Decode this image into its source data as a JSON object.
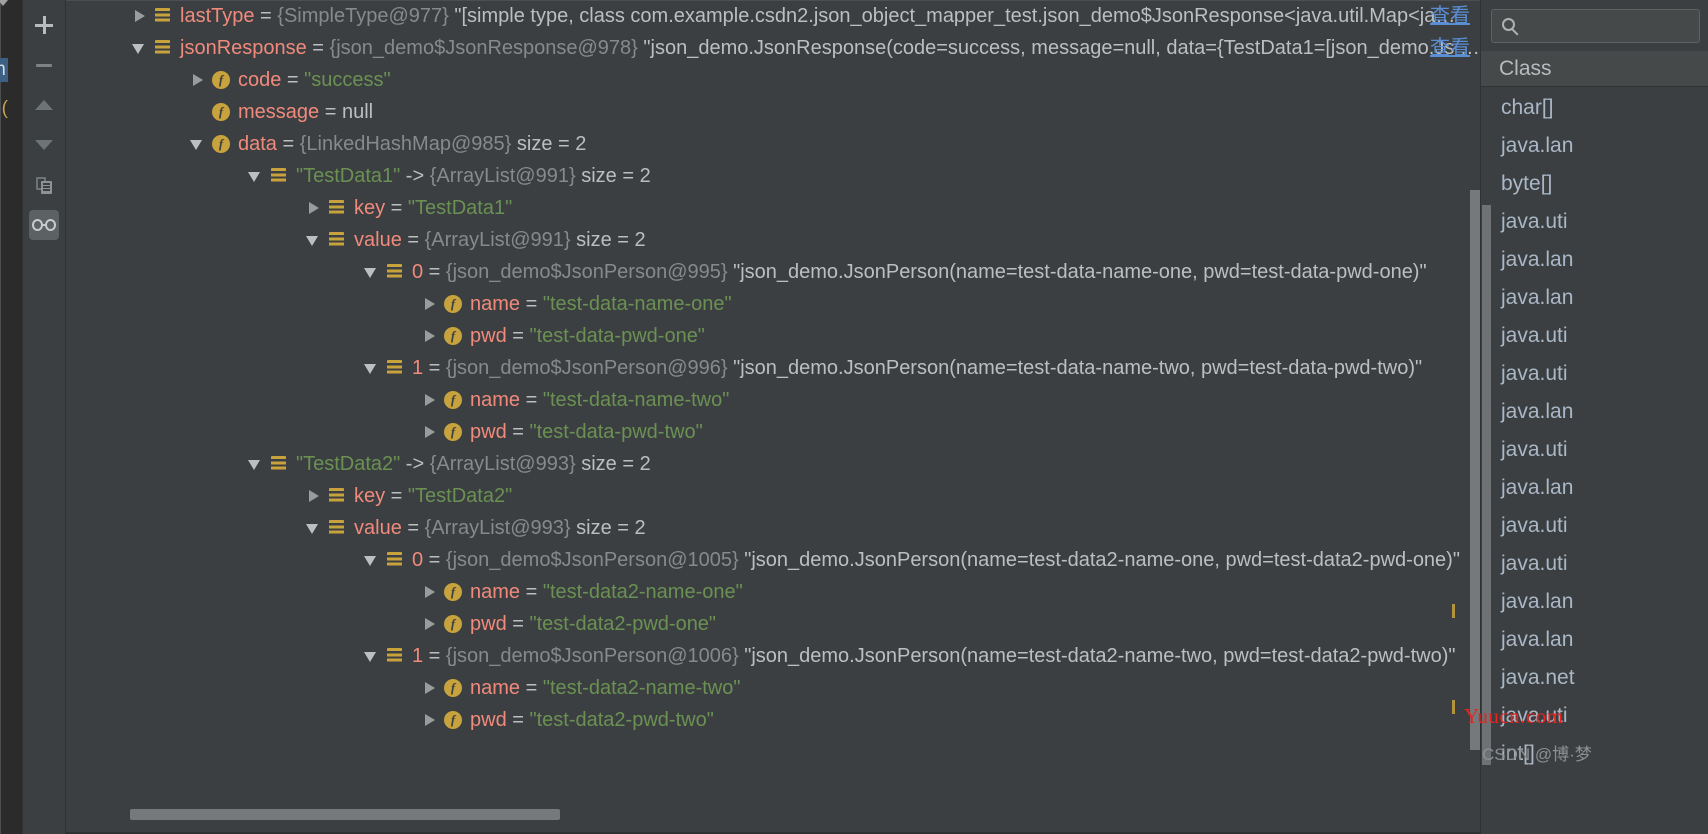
{
  "window": {
    "theme": "darcula",
    "colors": {
      "background": "#3c3f41",
      "editor_background": "#2b2b2b",
      "name": "#f08a7c",
      "type": "#868a8c",
      "string": "#6a9153",
      "plain": "#bcbfc1",
      "link": "#5a8fd6",
      "icon_gold": "#c8a23c",
      "selection": "#3d6185"
    }
  },
  "editor_sliver": {
    "selected_fragment": "m",
    "paren_fragment": ") ("
  },
  "toolbar": {
    "items": [
      {
        "name": "add-to-watches-button",
        "icon": "plus-icon",
        "label": "+",
        "active": false
      },
      {
        "name": "remove-watch-button",
        "icon": "minus-icon",
        "label": "−",
        "active": false
      },
      {
        "name": "move-watch-up-button",
        "icon": "arrow-up-icon",
        "label": "▲",
        "active": false
      },
      {
        "name": "move-watch-down-button",
        "icon": "arrow-down-icon",
        "label": "▼",
        "active": false
      },
      {
        "name": "copy-value-button",
        "icon": "copy-icon",
        "label": "⧉",
        "active": false
      },
      {
        "name": "inspect-toggle-button",
        "icon": "glasses-icon",
        "label": "∞",
        "active": true
      }
    ]
  },
  "variables_tree": {
    "rows": [
      {
        "indent": 0,
        "arrow": "collapsed",
        "icon": "node",
        "name": "lastType",
        "eq": "=",
        "type": "{SimpleType@977}",
        "tail": "\"[simple type, class com.example.csdn2.json_object_mapper_test.json_demo$JsonResponse<java.util.Map<ja…",
        "view_link": "查看"
      },
      {
        "indent": 0,
        "arrow": "expanded",
        "icon": "node",
        "name": "jsonResponse",
        "eq": "=",
        "type": "{json_demo$JsonResponse@978}",
        "tail": "\"json_demo.JsonResponse(code=success, message=null, data={TestData1=[json_demo.Js …",
        "view_link": "查看"
      },
      {
        "indent": 1,
        "arrow": "collapsed",
        "icon": "field",
        "name": "code",
        "eq": "=",
        "string": "\"success\""
      },
      {
        "indent": 1,
        "arrow": "none",
        "icon": "field",
        "name": "message",
        "eq": "=",
        "plain": "null"
      },
      {
        "indent": 1,
        "arrow": "expanded",
        "icon": "field",
        "name": "data",
        "eq": "=",
        "type": "{LinkedHashMap@985}",
        "size": "size = 2"
      },
      {
        "indent": 2,
        "arrow": "expanded",
        "icon": "node",
        "string": "\"TestData1\"",
        "arrowop": "->",
        "type": "{ArrayList@991}",
        "size": "size = 2"
      },
      {
        "indent": 3,
        "arrow": "collapsed",
        "icon": "node",
        "name": "key",
        "eq": "=",
        "string": "\"TestData1\""
      },
      {
        "indent": 3,
        "arrow": "expanded",
        "icon": "node",
        "name": "value",
        "eq": "=",
        "type": "{ArrayList@991}",
        "size": "size = 2"
      },
      {
        "indent": 4,
        "arrow": "expanded",
        "icon": "node",
        "name": "0",
        "eq": "=",
        "type": "{json_demo$JsonPerson@995}",
        "tail": "\"json_demo.JsonPerson(name=test-data-name-one, pwd=test-data-pwd-one)\""
      },
      {
        "indent": 5,
        "arrow": "collapsed",
        "icon": "field",
        "name": "name",
        "eq": "=",
        "string": "\"test-data-name-one\""
      },
      {
        "indent": 5,
        "arrow": "collapsed",
        "icon": "field",
        "name": "pwd",
        "eq": "=",
        "string": "\"test-data-pwd-one\""
      },
      {
        "indent": 4,
        "arrow": "expanded",
        "icon": "node",
        "name": "1",
        "eq": "=",
        "type": "{json_demo$JsonPerson@996}",
        "tail": "\"json_demo.JsonPerson(name=test-data-name-two, pwd=test-data-pwd-two)\""
      },
      {
        "indent": 5,
        "arrow": "collapsed",
        "icon": "field",
        "name": "name",
        "eq": "=",
        "string": "\"test-data-name-two\""
      },
      {
        "indent": 5,
        "arrow": "collapsed",
        "icon": "field",
        "name": "pwd",
        "eq": "=",
        "string": "\"test-data-pwd-two\""
      },
      {
        "indent": 2,
        "arrow": "expanded",
        "icon": "node",
        "string": "\"TestData2\"",
        "arrowop": "->",
        "type": "{ArrayList@993}",
        "size": "size = 2"
      },
      {
        "indent": 3,
        "arrow": "collapsed",
        "icon": "node",
        "name": "key",
        "eq": "=",
        "string": "\"TestData2\""
      },
      {
        "indent": 3,
        "arrow": "expanded",
        "icon": "node",
        "name": "value",
        "eq": "=",
        "type": "{ArrayList@993}",
        "size": "size = 2"
      },
      {
        "indent": 4,
        "arrow": "expanded",
        "icon": "node",
        "name": "0",
        "eq": "=",
        "type": "{json_demo$JsonPerson@1005}",
        "tail": "\"json_demo.JsonPerson(name=test-data2-name-one, pwd=test-data2-pwd-one)\""
      },
      {
        "indent": 5,
        "arrow": "collapsed",
        "icon": "field",
        "name": "name",
        "eq": "=",
        "string": "\"test-data2-name-one\""
      },
      {
        "indent": 5,
        "arrow": "collapsed",
        "icon": "field",
        "name": "pwd",
        "eq": "=",
        "string": "\"test-data2-pwd-one\""
      },
      {
        "indent": 4,
        "arrow": "expanded",
        "icon": "node",
        "name": "1",
        "eq": "=",
        "type": "{json_demo$JsonPerson@1006}",
        "tail": "\"json_demo.JsonPerson(name=test-data2-name-two, pwd=test-data2-pwd-two)\""
      },
      {
        "indent": 5,
        "arrow": "collapsed",
        "icon": "field",
        "name": "name",
        "eq": "=",
        "string": "\"test-data2-name-two\""
      },
      {
        "indent": 5,
        "arrow": "collapsed",
        "icon": "field",
        "name": "pwd",
        "eq": "=",
        "string": "\"test-data2-pwd-two\""
      }
    ]
  },
  "class_panel": {
    "search_placeholder": "",
    "header": "Class",
    "items": [
      "char[]",
      "java.lan",
      "byte[]",
      "java.uti",
      "java.lan",
      "java.lan",
      "java.uti",
      "java.uti",
      "java.lan",
      "java.uti",
      "java.lan",
      "java.uti",
      "java.uti",
      "java.lan",
      "java.lan",
      "java.net",
      "java.uti",
      "int[]"
    ]
  },
  "watermarks": {
    "primary": "Yuucn.com",
    "secondary": "CSDN @博·梦"
  }
}
